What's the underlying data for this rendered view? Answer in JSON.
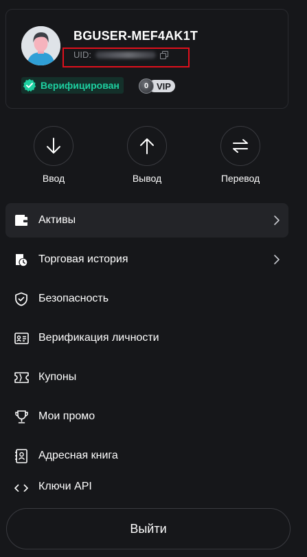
{
  "profile": {
    "username": "BGUSER-MEF4AK1T",
    "uid_label": "UID:",
    "verified_label": "Верифицирован",
    "vip_level": "0",
    "vip_label": "VIP"
  },
  "actions": [
    {
      "label": "Ввод",
      "icon": "arrow-down-icon"
    },
    {
      "label": "Вывод",
      "icon": "arrow-up-icon"
    },
    {
      "label": "Перевод",
      "icon": "transfer-icon"
    }
  ],
  "menu": {
    "assets": "Активы",
    "trade_history": "Торговая история",
    "security": "Безопасность",
    "identity_verification": "Верификация личности",
    "coupons": "Купоны",
    "my_promo": "Мои промо",
    "address_book": "Адресная книга",
    "api_partial": "Ключи API"
  },
  "logout_label": "Выйти",
  "colors": {
    "background": "#16171a",
    "accent_verified": "#1dd1a1",
    "highlight_box": "#e0101c"
  }
}
